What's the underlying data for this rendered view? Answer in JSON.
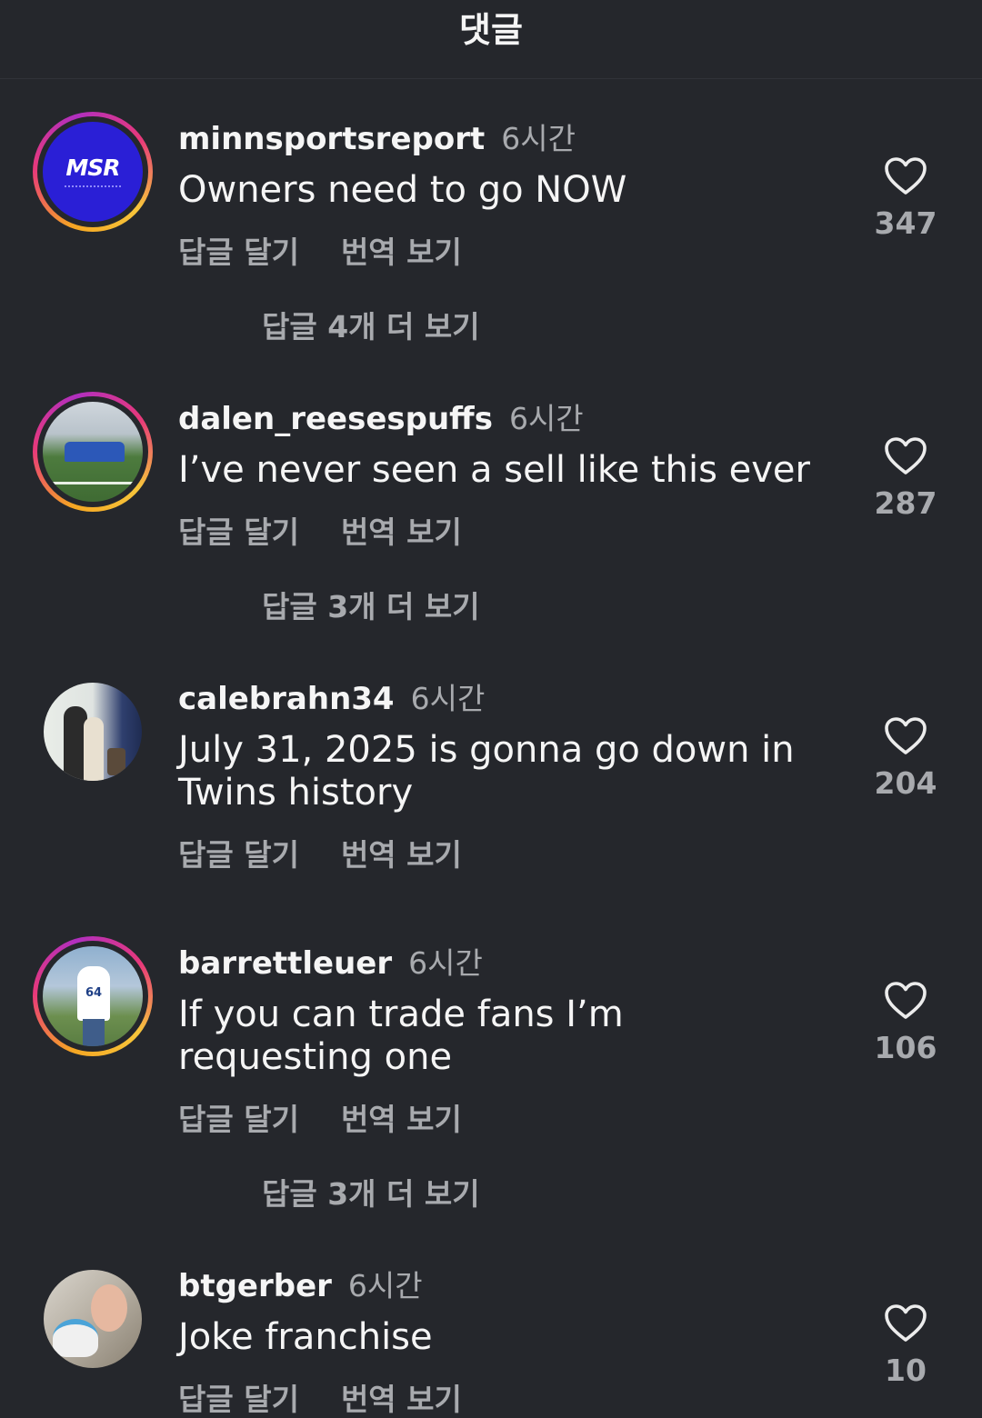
{
  "header": {
    "title": "댓글"
  },
  "comments": [
    {
      "username": "minnsportsreport",
      "time": "6시간",
      "text": "Owners need to go NOW",
      "reply": "답글 달기",
      "translate": "번역 보기",
      "likes": "347",
      "more_replies": "답글 4개 더 보기",
      "avatar_text": "MSR"
    },
    {
      "username": "dalen_reesespuffs",
      "time": "6시간",
      "text": "I’ve never seen a sell like this ever",
      "reply": "답글 달기",
      "translate": "번역 보기",
      "likes": "287",
      "more_replies": "답글 3개 더 보기"
    },
    {
      "username": "calebrahn34",
      "time": "6시간",
      "text": "July 31, 2025 is gonna go down in Twins history",
      "reply": "답글 달기",
      "translate": "번역 보기",
      "likes": "204"
    },
    {
      "username": "barrettleuer",
      "time": "6시간",
      "text": "If you can trade fans I’m requesting one",
      "reply": "답글 달기",
      "translate": "번역 보기",
      "likes": "106",
      "more_replies": "답글 3개 더 보기",
      "jersey_number": "64"
    },
    {
      "username": "btgerber",
      "time": "6시간",
      "text": "Joke franchise",
      "reply": "답글 달기",
      "translate": "번역 보기",
      "likes": "10"
    }
  ],
  "colors": {
    "background": "#25272c",
    "primary_text": "#f5f5f5",
    "secondary_text": "#a8aaae",
    "story_ring": "#e8397a"
  }
}
